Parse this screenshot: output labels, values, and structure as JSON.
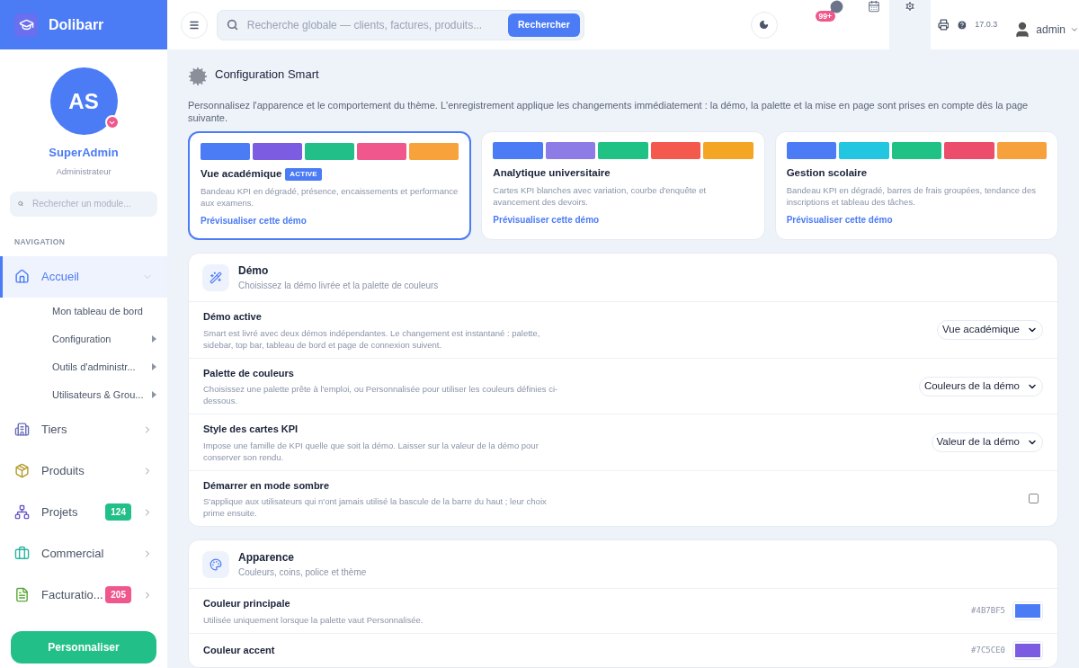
{
  "brand": {
    "name": "Dolibarr"
  },
  "user": {
    "initials": "AS",
    "name": "SuperAdmin",
    "role": "Administrateur"
  },
  "module_search": {
    "placeholder": "Rechercher un module..."
  },
  "nav_heading": "NAVIGATION",
  "nav": [
    {
      "label": "Accueil",
      "selected": true,
      "expanded": true,
      "children": [
        {
          "label": "Mon tableau de bord",
          "has_children": false
        },
        {
          "label": "Configuration",
          "has_children": true
        },
        {
          "label": "Outils d'administr...",
          "has_children": true
        },
        {
          "label": "Utilisateurs & Grou...",
          "has_children": true
        }
      ]
    },
    {
      "label": "Tiers",
      "selected": false,
      "expanded": false
    },
    {
      "label": "Produits",
      "selected": false,
      "expanded": false
    },
    {
      "label": "Projets",
      "selected": false,
      "expanded": false,
      "badge": "124",
      "color": "#22c088"
    },
    {
      "label": "Commercial",
      "selected": false,
      "expanded": false
    },
    {
      "label": "Facturatio...",
      "selected": false,
      "expanded": false,
      "badge": "205",
      "color": "#f0578c"
    }
  ],
  "customize_button": "Personnaliser",
  "topbar": {
    "search_placeholder": "Recherche globale — clients, factures, produits...",
    "search_button": "Rechercher",
    "messages_badge": "99+",
    "version": "17.0.3",
    "user": "admin"
  },
  "page": {
    "title": "Configuration Smart",
    "intro": "Personnalisez l'apparence et le comportement du thème. L'enregistrement applique les changements immédiatement : la démo, la palette et la mise en page sont prises en compte dès la page suivante."
  },
  "demos": [
    {
      "title": "Vue académique",
      "badge": "ACTIVE",
      "selected": true,
      "palette": [
        {
          "color": "#4b7bf5"
        },
        {
          "color": "#7c5ce0"
        },
        {
          "color": "#22c088"
        },
        {
          "color": "#f0578c"
        },
        {
          "color": "#f7a23b"
        }
      ],
      "description": "Bandeau KPI en dégradé, présence, encaissements et performance aux examens.",
      "link": "Prévisualiser cette démo"
    },
    {
      "title": "Analytique universitaire",
      "selected": false,
      "palette": [
        {
          "color": "#4b7bf5"
        },
        {
          "color": "#8e7ce6"
        },
        {
          "color": "#20c184"
        },
        {
          "color": "#f3594d"
        },
        {
          "color": "#f4a524"
        }
      ],
      "description": "Cartes KPI blanches avec variation, courbe d'enquête et avancement des devoirs.",
      "link": "Prévisualiser cette démo"
    },
    {
      "title": "Gestion scolaire",
      "selected": false,
      "palette": [
        {
          "color": "#4b7bf5"
        },
        {
          "color": "#22c6e0"
        },
        {
          "color": "#20c184"
        },
        {
          "color": "#ec4d6a"
        },
        {
          "color": "#f7a13d"
        }
      ],
      "description": "Bandeau KPI en dégradé, barres de frais groupées, tendance des inscriptions et tableau des tâches.",
      "link": "Prévisualiser cette démo"
    }
  ],
  "sections": [
    {
      "title": "Démo",
      "subtitle": "Choisissez la démo livrée et la palette de couleurs",
      "rows": [
        {
          "kind": "select",
          "label": "Démo active",
          "description": "Smart est livré avec deux démos indépendantes. Le changement est instantané : palette, sidebar, top bar, tableau de bord et page de connexion suivent.",
          "value": "Vue académique"
        },
        {
          "kind": "select",
          "label": "Palette de couleurs",
          "description": "Choisissez une palette prête à l'emploi, ou Personnalisée pour utiliser les couleurs définies ci-dessous.",
          "value": "Couleurs de la démo"
        },
        {
          "kind": "select",
          "label": "Style des cartes KPI",
          "description": "Impose une famille de KPI quelle que soit la démo. Laisser sur la valeur de la démo pour conserver son rendu.",
          "value": "Valeur de la démo"
        },
        {
          "kind": "checkbox",
          "label": "Démarrer en mode sombre",
          "description": "S'applique aux utilisateurs qui n'ont jamais utilisé la bascule de la barre du haut ; leur choix prime ensuite.",
          "checked": false
        }
      ]
    },
    {
      "title": "Apparence",
      "subtitle": "Couleurs, coins, police et thème",
      "rows": [
        {
          "kind": "color",
          "label": "Couleur principale",
          "description": "Utilisée uniquement lorsque la palette vaut Personnalisée.",
          "value": "#4B7BF5",
          "color": "#4b7bf5"
        },
        {
          "kind": "color",
          "label": "Couleur accent",
          "value": "#7C5CE0",
          "color": "#7c5ce0"
        }
      ]
    }
  ]
}
